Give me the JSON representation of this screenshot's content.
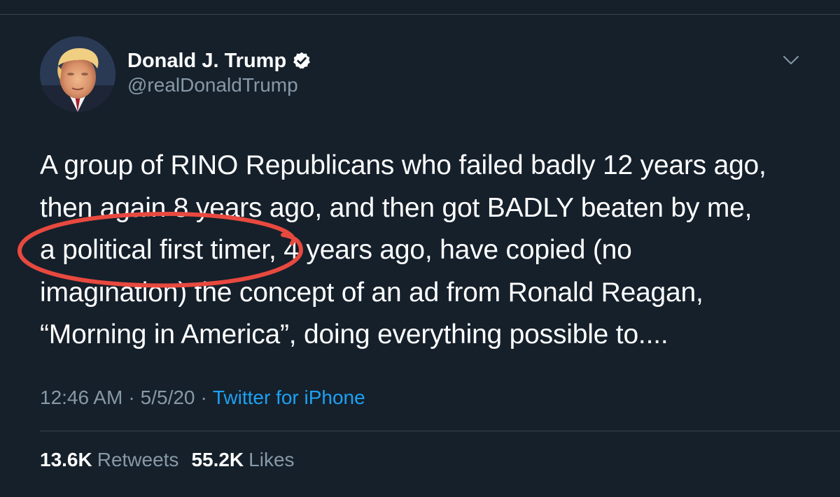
{
  "tweet": {
    "author": {
      "display_name": "Donald J. Trump",
      "handle": "@realDonaldTrump",
      "verified": true
    },
    "text_lines": [
      "A group of RINO Republicans who failed badly 12 years ago,",
      "then again 8 years ago, and then got BADLY beaten by me,",
      "a political first timer, 4 years ago, have copied (no",
      "imagination) the concept of an ad from Ronald Reagan,",
      "“Morning in America”, doing everything possible to...."
    ],
    "timestamp_time": "12:46 AM",
    "timestamp_separator": "·",
    "timestamp_date": "5/5/20",
    "source": "Twitter for iPhone",
    "stats": {
      "retweets_count": "13.6K",
      "retweets_label": "Retweets",
      "likes_count": "55.2K",
      "likes_label": "Likes"
    }
  },
  "icons": {
    "verified": "verified-badge-icon",
    "more": "chevron-down-icon"
  },
  "colors": {
    "background": "#15202b",
    "text_primary": "#ffffff",
    "text_secondary": "#8899a6",
    "link": "#1da1f2",
    "divider": "#38444d",
    "annotation": "#e8493f"
  }
}
